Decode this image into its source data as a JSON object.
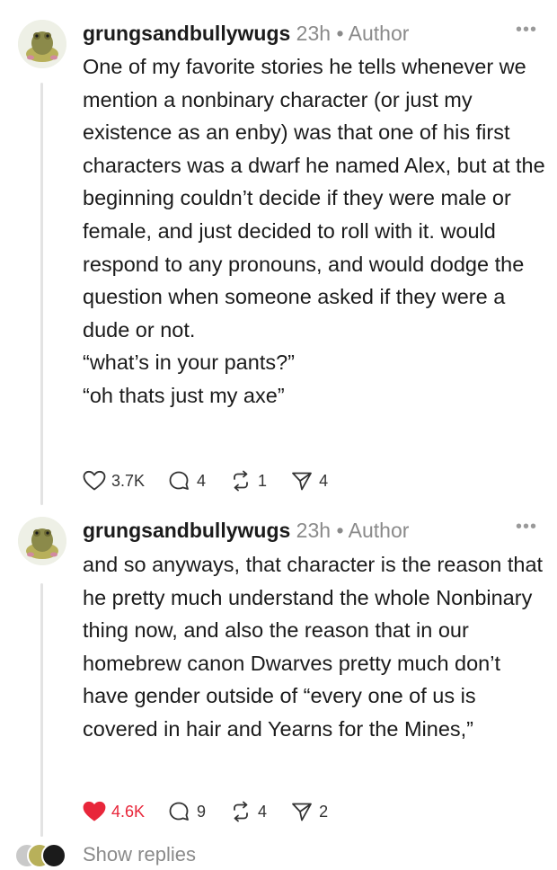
{
  "posts": [
    {
      "username": "grungsandbullywugs",
      "time": "23h",
      "badge": "Author",
      "more": "•••",
      "lines": [
        "One of my favorite stories he tells whenever we mention a nonbinary character (or just my existence as an enby) was that one of his first characters was a dwarf he named Alex, but at the beginning couldn’t decide if they were male or female, and just decided to roll with it. would respond to any pronouns, and would dodge the question when someone asked if they were a dude or not.",
        "“what’s in your pants?”",
        "“oh thats just my axe”"
      ],
      "likes": "3.7K",
      "liked": false,
      "comments": "4",
      "reposts": "1",
      "shares": "4"
    },
    {
      "username": "grungsandbullywugs",
      "time": "23h",
      "badge": "Author",
      "more": "•••",
      "lines": [
        "and so anyways, that character is the reason that he pretty much understand the whole Nonbinary thing now, and also the reason that in our homebrew canon Dwarves pretty much don’t have gender outside of “every one of us is covered in hair and Yearns for the Mines,”"
      ],
      "likes": "4.6K",
      "liked": true,
      "comments": "9",
      "reposts": "4",
      "shares": "2"
    }
  ],
  "show_replies": "Show replies",
  "colors": {
    "like_active": "#e8263a",
    "muted": "#8a8a8a"
  }
}
